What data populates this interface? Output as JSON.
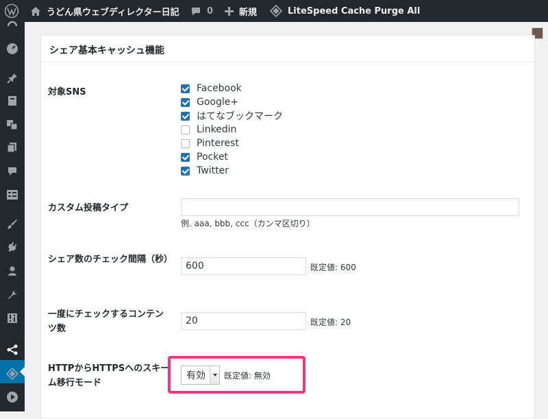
{
  "adminbar": {
    "site_title": "うどん県ウェブディレクター日記",
    "comments_count": "0",
    "new_label": "新規",
    "litespeed_label": "LiteSpeed Cache Purge All"
  },
  "sidebar": {
    "icons": [
      "dashboard-icon",
      "pin-icon",
      "media-icon",
      "pages-icon",
      "copy-icon",
      "comment-icon",
      "form-icon",
      "appearance-icon",
      "plugins-icon",
      "users-icon",
      "tools-icon",
      "settings-icon",
      "share-icon",
      "litespeed-icon",
      "play-icon"
    ],
    "active": "share-icon"
  },
  "panel": {
    "title": "シェア基本キャッシュ機能",
    "sns_label": "対象SNS",
    "sns_options": [
      {
        "label": "Facebook",
        "checked": true
      },
      {
        "label": "Google+",
        "checked": true
      },
      {
        "label": "はてなブックマーク",
        "checked": true
      },
      {
        "label": "Linkedin",
        "checked": false
      },
      {
        "label": "Pinterest",
        "checked": false
      },
      {
        "label": "Pocket",
        "checked": true
      },
      {
        "label": "Twitter",
        "checked": true
      }
    ],
    "custom_post_label": "カスタム投稿タイプ",
    "custom_post_value": "",
    "custom_post_desc": "例. aaa, bbb, ccc（カンマ区切り）",
    "interval_label": "シェア数のチェック間隔（秒）",
    "interval_value": "600",
    "interval_default": "既定値: 600",
    "batch_label": "一度にチェックするコンテンツ数",
    "batch_value": "20",
    "batch_default": "既定値: 20",
    "scheme_label": "HTTPからHTTPSへのスキーム移行モード",
    "scheme_value": "有効",
    "scheme_default": "既定値: 無効"
  },
  "colors": {
    "adminbar": "#23282d",
    "active_menu": "#0073aa",
    "highlight": "#f0367d",
    "checkbox": "#2271b1"
  }
}
